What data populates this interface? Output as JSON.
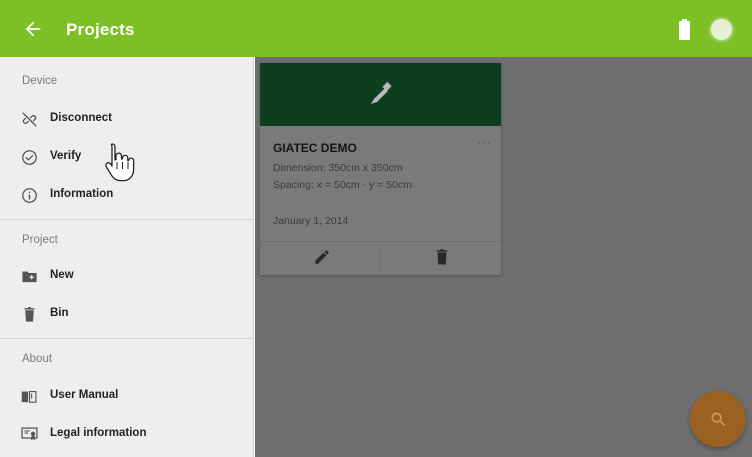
{
  "app_bar": {
    "title": "Projects",
    "color": "#7cbf26",
    "back_icon": "arrow-back-icon",
    "battery_icon": "battery-icon",
    "status_icon": "connection-status-icon"
  },
  "drawer": {
    "sections": [
      {
        "header": "Device",
        "items": [
          {
            "label": "Disconnect",
            "icon": "link-off-icon"
          },
          {
            "label": "Verify",
            "icon": "check-circle-icon"
          },
          {
            "label": "Information",
            "icon": "info-icon"
          }
        ]
      },
      {
        "header": "Project",
        "items": [
          {
            "label": "New",
            "icon": "new-folder-icon"
          },
          {
            "label": "Bin",
            "icon": "trash-icon"
          }
        ]
      },
      {
        "header": "About",
        "items": [
          {
            "label": "User Manual",
            "icon": "book-icon"
          },
          {
            "label": "Legal information",
            "icon": "certificate-icon"
          }
        ]
      }
    ]
  },
  "project_card": {
    "name": "GIATEC DEMO",
    "dimension": "Dimension: 350cm x 350cm",
    "spacing": "Spacing: x = 50cm - y = 50cm",
    "date": "January 1, 2014",
    "more_label": "···",
    "banner_color": "#0d3f1f",
    "banner_icon": "probe-icon",
    "actions": {
      "edit_icon": "pencil-icon",
      "delete_icon": "trash-icon"
    }
  },
  "fab": {
    "icon": "search-icon",
    "color": "#9a6121"
  }
}
